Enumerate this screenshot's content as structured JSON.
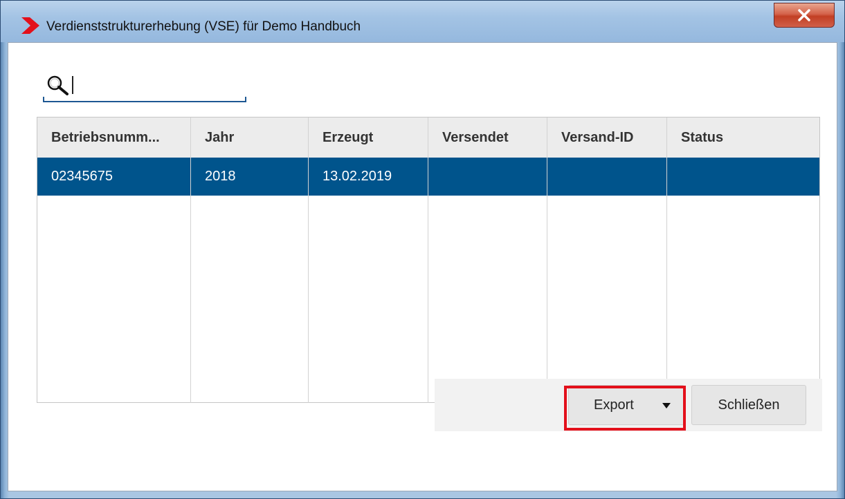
{
  "window": {
    "title": "Verdienststrukturerhebung (VSE) für Demo Handbuch",
    "accent_color": "#e3101b",
    "close_icon": "close-icon"
  },
  "search": {
    "value": "",
    "placeholder": "",
    "icon": "search-icon"
  },
  "table": {
    "columns": [
      "Betriebsnumm...",
      "Jahr",
      "Erzeugt",
      "Versendet",
      "Versand-ID",
      "Status"
    ],
    "rows": [
      [
        "02345675",
        "2018",
        "13.02.2019",
        "",
        "",
        ""
      ]
    ],
    "selected_row_color": "#00548c"
  },
  "buttons": {
    "export_label": "Export",
    "close_label": "Schließen"
  }
}
